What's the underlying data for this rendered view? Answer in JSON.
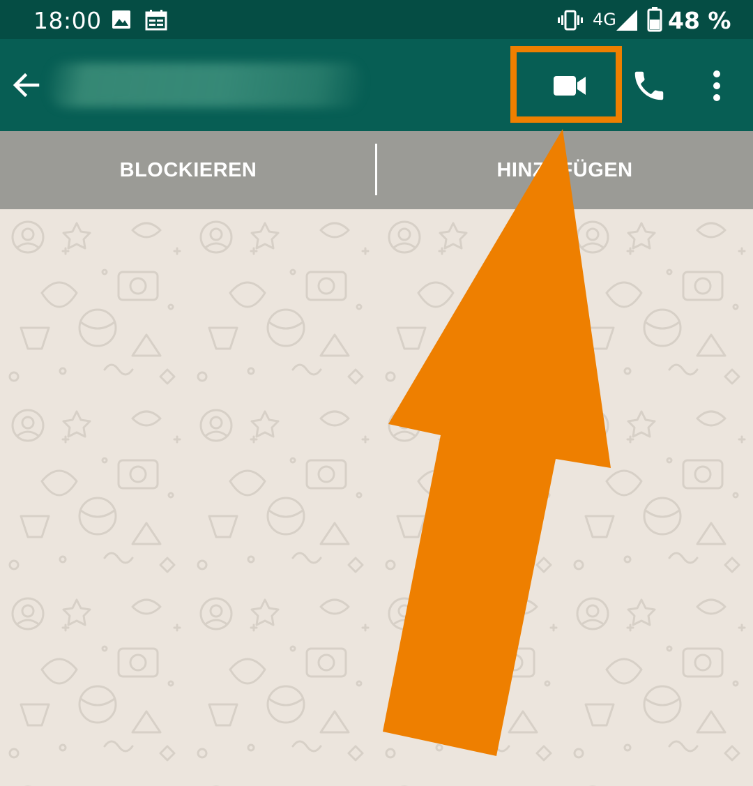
{
  "status_bar": {
    "time": "18:00",
    "network": "4G",
    "battery": "48 %",
    "icons": [
      "image-icon",
      "calendar-icon",
      "vibrate-icon",
      "signal-icon",
      "battery-icon"
    ]
  },
  "app_bar": {
    "icons": [
      "back-arrow-icon",
      "video-call-icon",
      "phone-call-icon",
      "more-vert-icon"
    ]
  },
  "action_bar": {
    "block_label": "BLOCKIEREN",
    "add_label": "HINZUFÜGEN"
  },
  "annotation": {
    "color": "#ee7f00",
    "target": "video-call-button"
  },
  "colors": {
    "status_bar": "#054d44",
    "app_bar": "#075e54",
    "action_bar": "#9b9b96",
    "chat_background": "#ece5dd"
  }
}
